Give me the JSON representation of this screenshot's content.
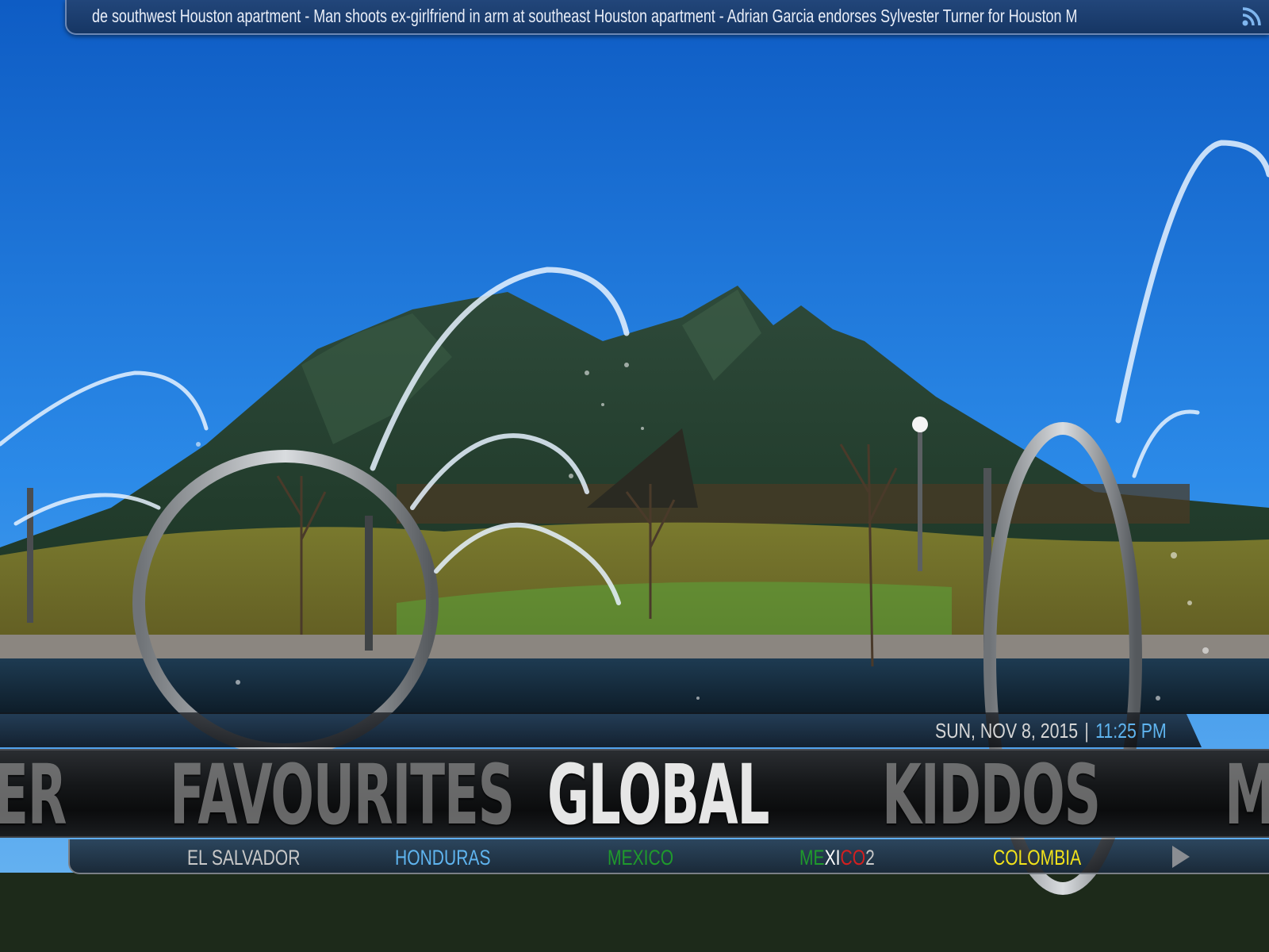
{
  "ticker": {
    "text": "de southwest Houston apartment - Man shoots ex-girlfriend in arm at southeast Houston apartment - Adrian Garcia endorses Sylvester Turner for Houston M",
    "icon": "rss-icon"
  },
  "datetime": {
    "date": "SUN, NOV 8, 2015",
    "separator": "|",
    "time": "11:25 PM"
  },
  "main_menu": {
    "items": [
      {
        "label": "ER"
      },
      {
        "label": "FAVOURITES"
      },
      {
        "label": "GLOBAL"
      },
      {
        "label": "KIDDOS"
      },
      {
        "label": "M"
      }
    ],
    "selected": "GLOBAL"
  },
  "submenu": {
    "items": [
      {
        "label": "EL SALVADOR",
        "color": "#c8c8c8"
      },
      {
        "label": "HONDURAS",
        "color": "#5fb4ef"
      },
      {
        "label": "MEXICO",
        "color": "#1f9a2c"
      },
      {
        "label": "MEXICO2",
        "color": "#ffffff"
      },
      {
        "label": "COLOMBIA",
        "color": "#f2e21a"
      }
    ],
    "mexico2_parts": [
      "ME",
      "XI",
      "CO",
      "2"
    ],
    "mexico2_colors": [
      "#1f9a2c",
      "#ffffff",
      "#d41f1f",
      "#c8c8c8"
    ],
    "next_icon": "play-arrow-icon"
  },
  "colors": {
    "ticker_bg": "#1c3e70",
    "accent_time": "#5fb4ef",
    "sky": "#1a7ad8"
  }
}
